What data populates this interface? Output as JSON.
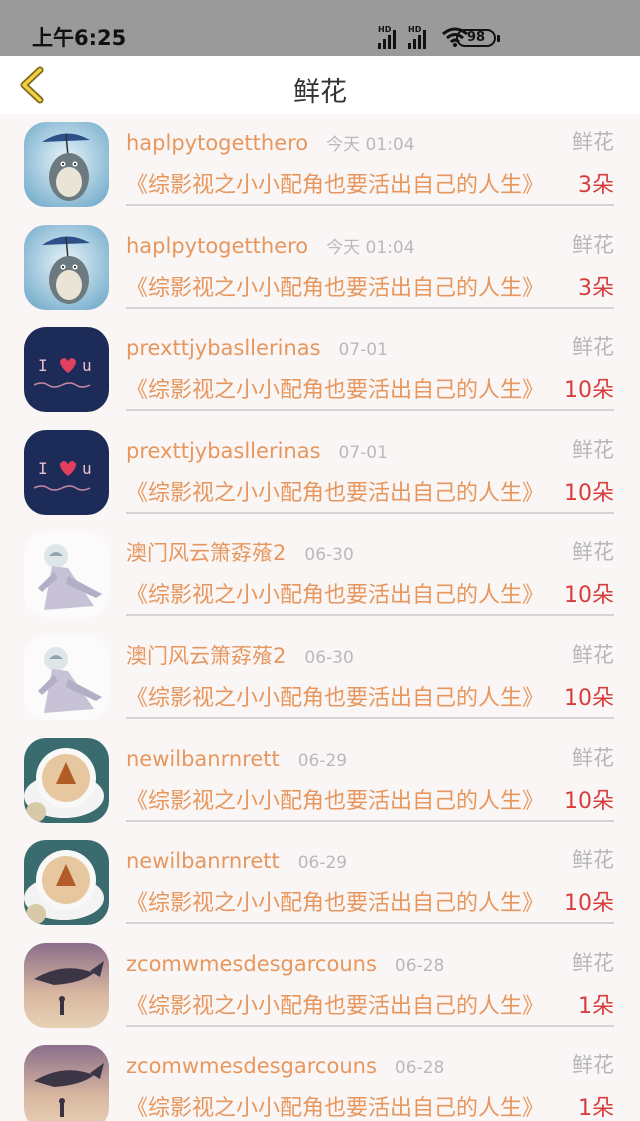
{
  "status": {
    "time": "上午6:25",
    "battery": "98",
    "signal_label": "HD"
  },
  "header": {
    "title": "鲜花",
    "back_icon": "chevron-left-icon"
  },
  "colors": {
    "accent": "#e7975d",
    "count": "#d93c3c",
    "muted": "#b7b7b7"
  },
  "items": [
    {
      "user": "haplpytogetthero",
      "time": "今天 01:04",
      "type": "鲜花",
      "book": "《综影视之小小配角也要活出自己的人生》",
      "count": "3朵",
      "avatar": "totoro"
    },
    {
      "user": "haplpytogetthero",
      "time": "今天 01:04",
      "type": "鲜花",
      "book": "《综影视之小小配角也要活出自己的人生》",
      "count": "3朵",
      "avatar": "totoro"
    },
    {
      "user": "prexttjybasllerinas",
      "time": "07-01",
      "type": "鲜花",
      "book": "《综影视之小小配角也要活出自己的人生》",
      "count": "10朵",
      "avatar": "iloveu"
    },
    {
      "user": "prexttjybasllerinas",
      "time": "07-01",
      "type": "鲜花",
      "book": "《综影视之小小配角也要活出自己的人生》",
      "count": "10朵",
      "avatar": "iloveu"
    },
    {
      "user": "澳门风云箫孬蕵2",
      "time": "06-30",
      "type": "鲜花",
      "book": "《综影视之小小配角也要活出自己的人生》",
      "count": "10朵",
      "avatar": "ghost"
    },
    {
      "user": "澳门风云箫孬蕵2",
      "time": "06-30",
      "type": "鲜花",
      "book": "《综影视之小小配角也要活出自己的人生》",
      "count": "10朵",
      "avatar": "ghost"
    },
    {
      "user": "newilbanrnrett",
      "time": "06-29",
      "type": "鲜花",
      "book": "《综影视之小小配角也要活出自己的人生》",
      "count": "10朵",
      "avatar": "coffee"
    },
    {
      "user": "newilbanrnrett",
      "time": "06-29",
      "type": "鲜花",
      "book": "《综影视之小小配角也要活出自己的人生》",
      "count": "10朵",
      "avatar": "coffee"
    },
    {
      "user": "zcomwmesdesgarcouns",
      "time": "06-28",
      "type": "鲜花",
      "book": "《综影视之小小配角也要活出自己的人生》",
      "count": "1朵",
      "avatar": "whale"
    },
    {
      "user": "zcomwmesdesgarcouns",
      "time": "06-28",
      "type": "鲜花",
      "book": "《综影视之小小配角也要活出自己的人生》",
      "count": "1朵",
      "avatar": "whale"
    }
  ]
}
